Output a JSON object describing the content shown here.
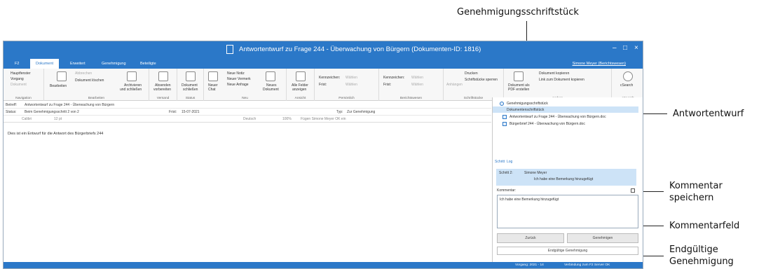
{
  "callouts": {
    "genehmigung": "Genehmigungsschriftstück",
    "antwort": "Antwortentwurf",
    "kommentar_speichern_1": "Kommentar",
    "kommentar_speichern_2": "speichern",
    "kommentarfeld": "Kommentarfeld",
    "endgueltig_1": "Endgültige",
    "endgueltig_2": "Genehmigung"
  },
  "window": {
    "title": "Antwortentwurf zu Frage 244 - Überwachung von Bürgern (Dokumenten-ID: 1816)",
    "minimize": "–",
    "maximize": "□",
    "close": "×"
  },
  "tabs": {
    "f2": "F2",
    "dokument": "Dokument",
    "erweitert": "Erweitert",
    "genehmigung": "Genehmigung",
    "beteiligte": "Beteiligte",
    "user": "Simone Meyer (Berichtswesen)"
  },
  "ribbon": {
    "nav": {
      "hauptfenster": "Hauptfenster",
      "vorgang": "Vorgang",
      "dokument": "Dokument",
      "label": "Navigation"
    },
    "bearbeiten": {
      "bearbeiten": "Bearbeiten",
      "abbrechen": "Abbrechen",
      "loeschen": "Dokument löschen",
      "archivieren_1": "Archivieren",
      "archivieren_2": "und schließen",
      "label": "Bearbeiten"
    },
    "versand": {
      "l1": "Absenden",
      "l2": "vorbereiten",
      "label": "Versand"
    },
    "status": {
      "l1": "Dokument",
      "l2": "schließen",
      "label": "Status"
    },
    "neu": {
      "chat_1": "Neuer",
      "chat_2": "Chat",
      "notiz": "Neue Notiz",
      "vermerk": "Neuer Vermerk",
      "anfrage": "Neue Anfrage",
      "dok_1": "Neues",
      "dok_2": "Dokument",
      "label": "Neu"
    },
    "ansicht": {
      "l1": "Alle Felder",
      "l2": "anzeigen",
      "label": "Ansicht"
    },
    "persoenlich": {
      "kenn": "Kennzeichen:",
      "frist": "Frist:",
      "waehlen1": "Wählen",
      "waehlen2": "Wählen",
      "label": "Persönlich"
    },
    "bericht": {
      "kenn": "Kennzeichen:",
      "frist": "Frist:",
      "waehlen1": "Wählen",
      "waehlen2": "Wählen",
      "label": "Berichtswesen"
    },
    "schrift": {
      "anhaengen": "Anhängen",
      "drucken": "Drucken",
      "sperren": "Schriftstücke sperren",
      "label": "Schriftstücke"
    },
    "andere": {
      "pdf_1": "Dokument als",
      "pdf_2": "PDF erstellen",
      "kopieren": "Dokument kopieren",
      "link": "Link zum Dokument kopieren",
      "label": "Andere"
    },
    "csearch": {
      "btn": "cSearch",
      "label": "cSearch"
    }
  },
  "fields": {
    "betreff_lbl": "Betreff:",
    "betreff_val": "Antwortentwurf zu Frage 244 - Überwachung von Bürgern",
    "status_lbl": "Status:",
    "status_val": "Beim Genehmigungsschritt 2 von 2",
    "frist_lbl": "Frist:",
    "frist_val": "15-07-2021",
    "typ_lbl": "Typ:",
    "typ_val": "Zur Genehmigung"
  },
  "format": {
    "font": "Calibri",
    "size": "12 pt",
    "lang": "Deutsch",
    "zoom": "100%",
    "rest": "Fügen Simone Meyer OK ein"
  },
  "doc_text": "Dies ist ein Entwurf für die Antwort des Bürgerbriefs 244",
  "panel": {
    "genehm": "Genehmigungsschriftstück",
    "dokschrift": "Dokumentenschriftstück",
    "file1": "Antwortentwurf zu Frage 244 - Überwachung von Bürgern.doc",
    "file2": "Bürgerbrief 244 - Überwachung von Bürgern.doc",
    "tab_schritt": "Schritt",
    "tab_log": "Log",
    "step_lbl": "Schritt 2:",
    "step_user": "Simone Meyer",
    "step_note": "Ich habe eine Bemerkung hinzugefügt",
    "kommentar_lbl": "Kommentar:",
    "kommentar_val": "Ich habe eine Bemerkung hinzugefügt",
    "zurueck": "Zurück",
    "genehmigen": "Genehmigen",
    "endgueltig": "Endgültige Genehmigung"
  },
  "statusbar": {
    "vorgang": "Vorgang: 2021 - 14",
    "verbindung": "Verbindung zum F2 Server OK"
  }
}
